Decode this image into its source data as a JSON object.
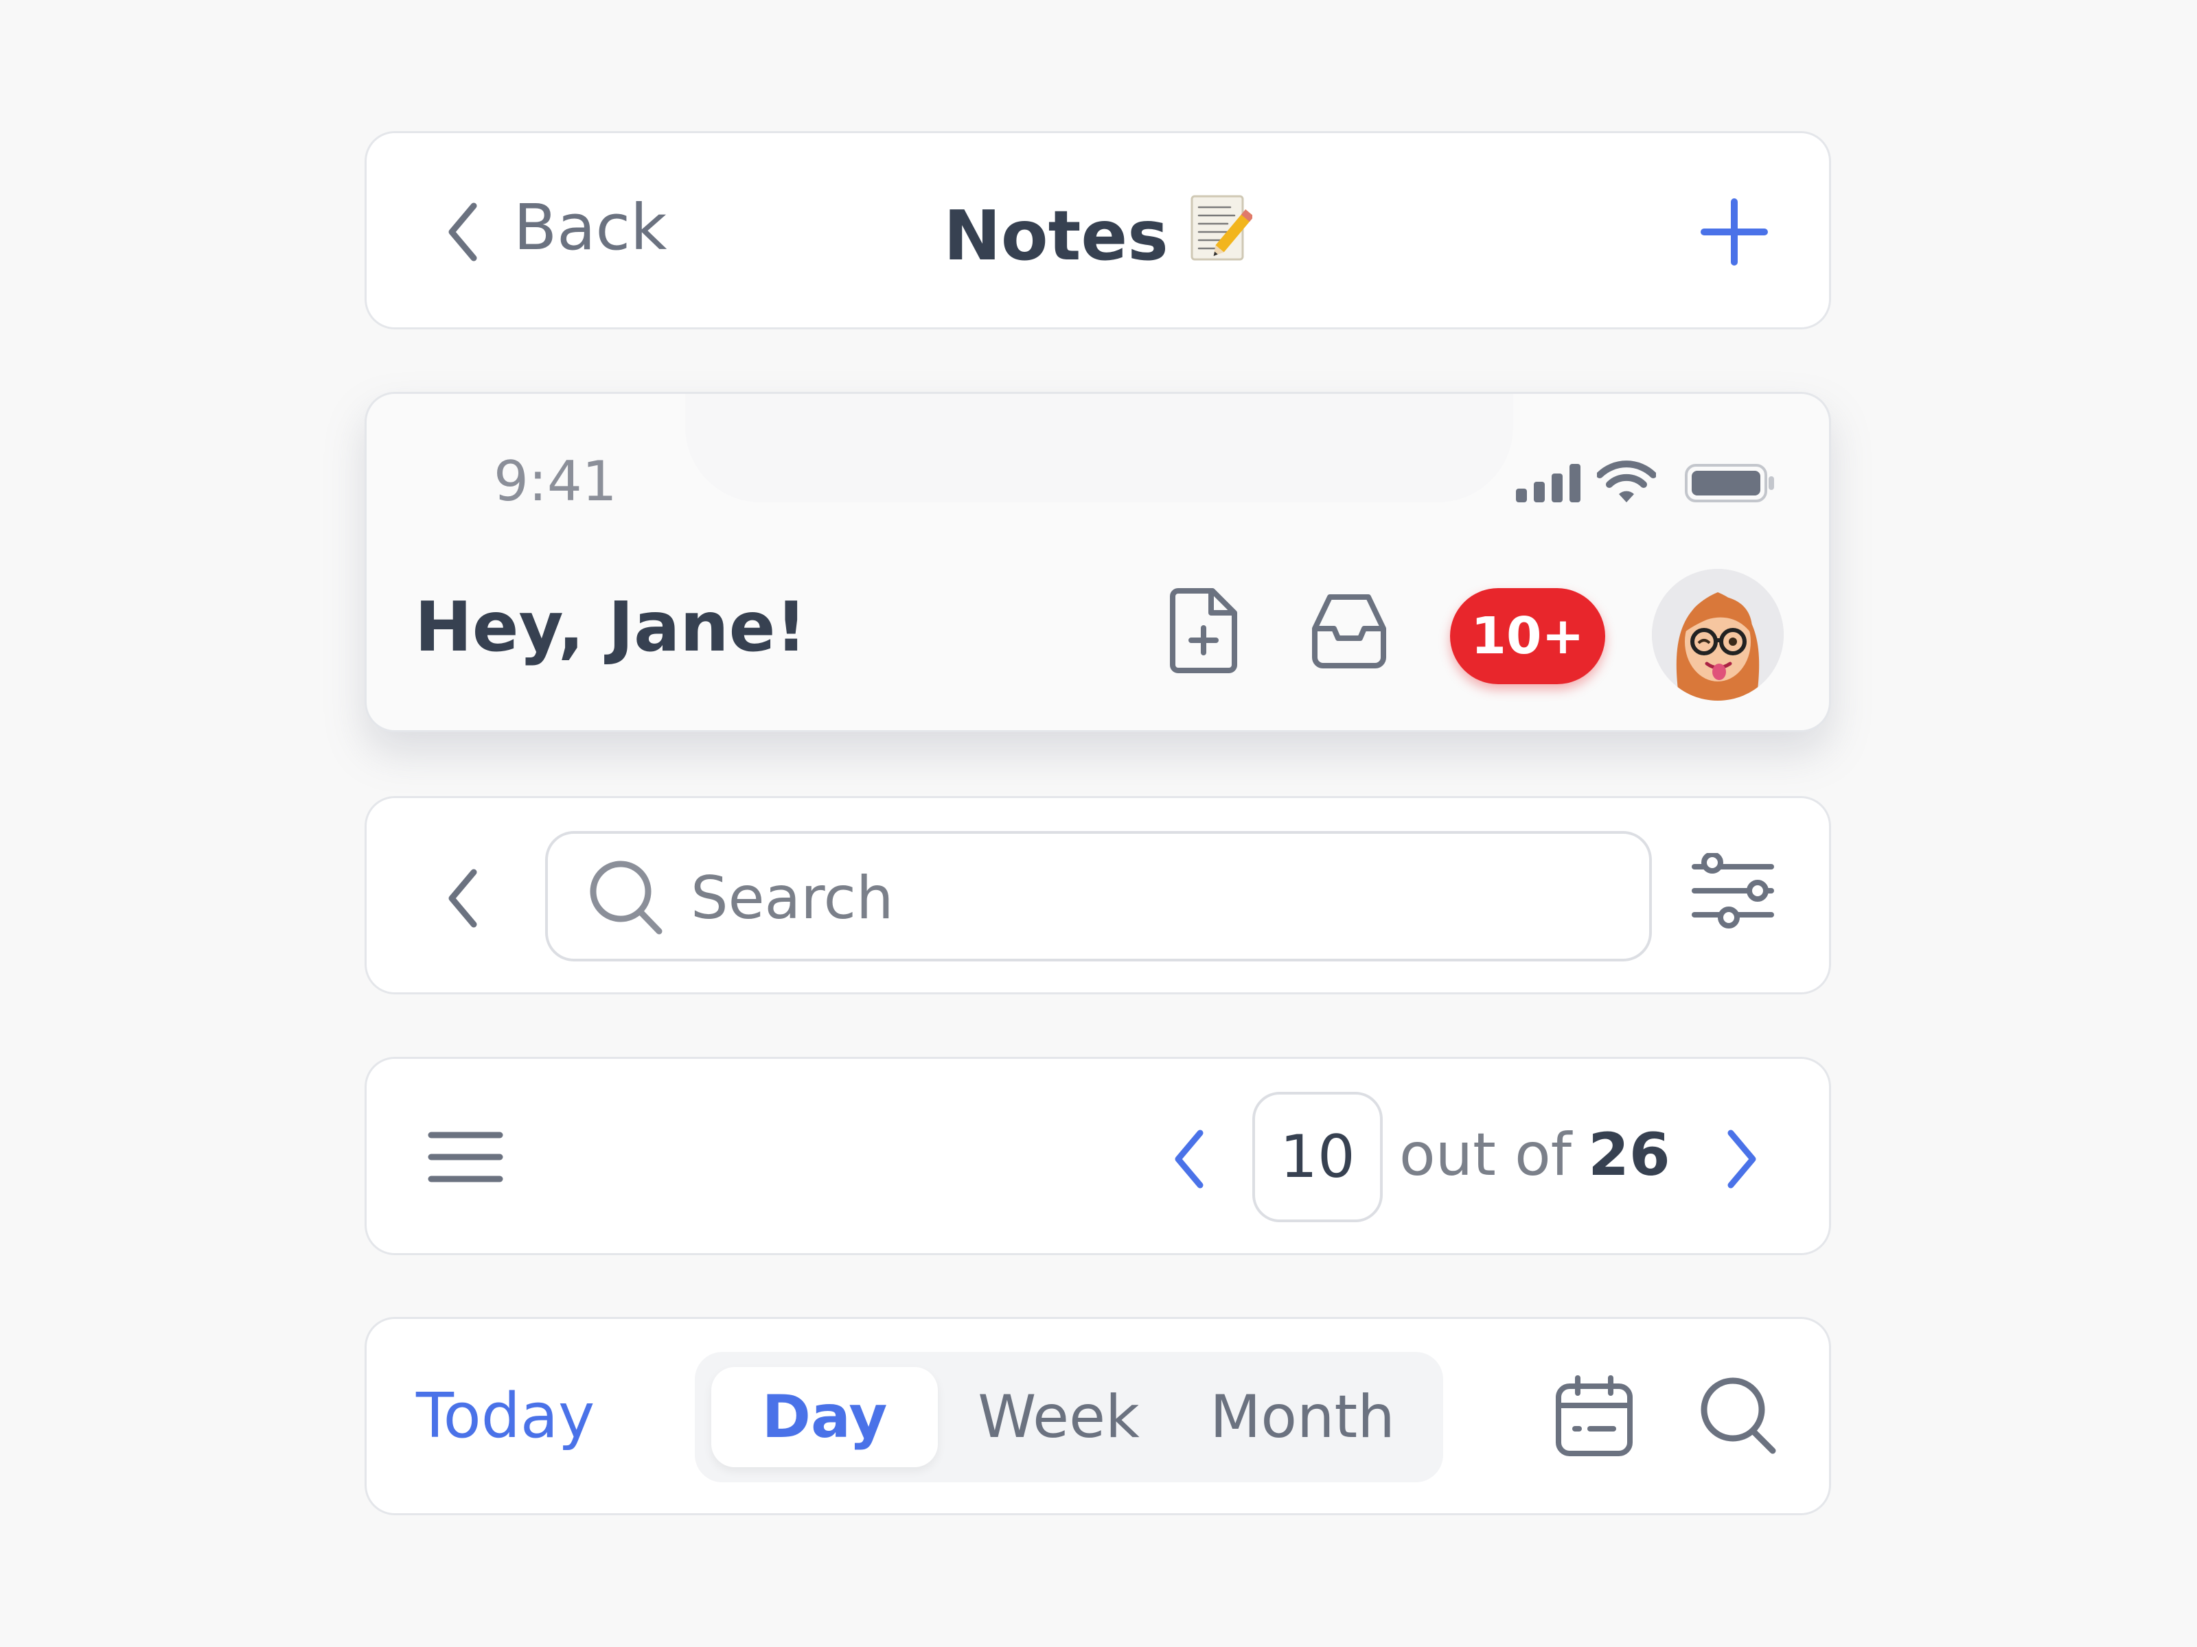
{
  "nav_bar": {
    "back_label": "Back",
    "title": "Notes",
    "title_emoji": "memo-icon",
    "add_icon": "plus-icon",
    "accent_color": "#4a72e8"
  },
  "header": {
    "status_bar": {
      "time": "9:41",
      "icons": [
        "cellular-signal-icon",
        "wifi-icon",
        "battery-icon"
      ]
    },
    "greeting": "Hey, Jane!",
    "actions": [
      "new-document-icon",
      "inbox-icon"
    ],
    "notification_badge": "10+",
    "badge_color": "#e8262c",
    "avatar": "memoji-avatar"
  },
  "search_bar": {
    "placeholder": "Search",
    "value": "",
    "icons": [
      "chevron-left-icon",
      "search-icon",
      "filter-sliders-icon"
    ]
  },
  "pagination": {
    "current_page": "10",
    "out_of_label": "out of",
    "total_pages": "26",
    "icons": [
      "menu-icon",
      "chevron-left-icon",
      "chevron-right-icon"
    ]
  },
  "calendar_bar": {
    "today_label": "Today",
    "segments": [
      {
        "label": "Day",
        "selected": true
      },
      {
        "label": "Week",
        "selected": false
      },
      {
        "label": "Month",
        "selected": false
      }
    ],
    "icons": [
      "calendar-icon",
      "search-icon"
    ]
  }
}
